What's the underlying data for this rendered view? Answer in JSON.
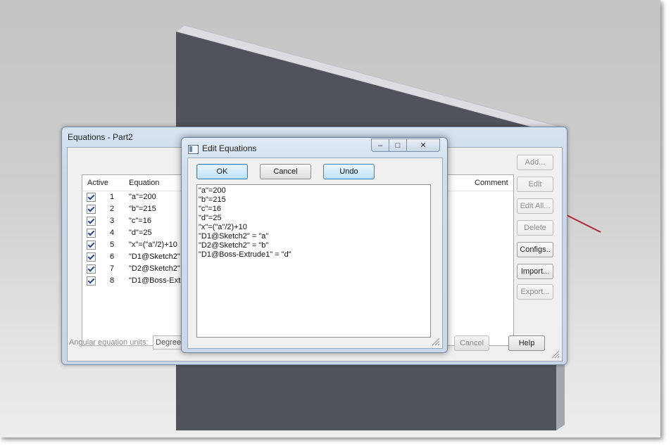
{
  "equations_window": {
    "title": "Equations - Part2",
    "columns": {
      "active": "Active",
      "equation": "Equation",
      "comment": "Comment"
    },
    "rows": [
      {
        "num": "1",
        "equation": "\"a\"=200"
      },
      {
        "num": "2",
        "equation": "\"b\"=215"
      },
      {
        "num": "3",
        "equation": "\"c\"=16"
      },
      {
        "num": "4",
        "equation": "\"d\"=25"
      },
      {
        "num": "5",
        "equation": "\"x\"=(\"a\"/2)+10"
      },
      {
        "num": "6",
        "equation": "\"D1@Sketch2\" ="
      },
      {
        "num": "7",
        "equation": "\"D2@Sketch2\" ="
      },
      {
        "num": "8",
        "equation": "\"D1@Boss-Extrud"
      }
    ],
    "side_buttons": {
      "add": "Add...",
      "edit": "Edit",
      "edit_all": "Edit All...",
      "delete": "Delete",
      "configs": "Configs..",
      "import": "Import...",
      "export": "Export..."
    },
    "angular_label": "Angular equation units:",
    "angular_value": "Degrees",
    "cancel": "Cancel",
    "help": "Help"
  },
  "edit_dialog": {
    "title": "Edit Equations",
    "ok": "OK",
    "cancel": "Cancel",
    "undo": "Undo",
    "minimize_glyph": "–",
    "maximize_glyph": "□",
    "close_glyph": "✕",
    "lines": [
      "\"a\"=200",
      "\"b\"=215",
      "\"c\"=16",
      "\"d\"=25",
      "\"x\"=(\"a\"/2)+10",
      "\"D1@Sketch2\" = \"a\"",
      "\"D2@Sketch2\" = \"b\"",
      "\"D1@Boss-Extrude1\" = \"d\""
    ]
  },
  "colors": {
    "part_face": "#50535c",
    "part_top": "#dcdde2",
    "part_side": "#a3a7b0",
    "arrow": "#b3262b"
  }
}
